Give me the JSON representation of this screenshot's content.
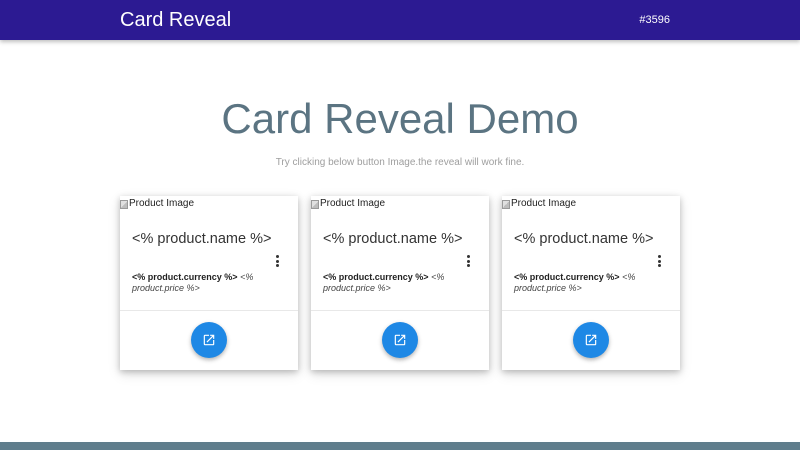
{
  "navbar": {
    "brand": "Card Reveal",
    "link": "#3596"
  },
  "hero": {
    "title": "Card Reveal Demo",
    "subtitle": "Try clicking below button Image.the reveal will work fine."
  },
  "cards": [
    {
      "image_alt": "Product Image",
      "title": "<% product.name %>",
      "currency": "<% product.currency %>",
      "price": "<% product.price %>",
      "icon": "open-in-new-icon"
    },
    {
      "image_alt": "Product Image",
      "title": "<% product.name %>",
      "currency": "<% product.currency %>",
      "price": "<% product.price %>",
      "icon": "open-in-new-icon"
    },
    {
      "image_alt": "Product Image",
      "title": "<% product.name %>",
      "currency": "<% product.currency %>",
      "price": "<% product.price %>",
      "icon": "open-in-new-icon"
    }
  ],
  "colors": {
    "navbar": "#2c1a92",
    "fab": "#1e88e5",
    "title": "#5b7482",
    "footer": "#5f7d8c"
  }
}
